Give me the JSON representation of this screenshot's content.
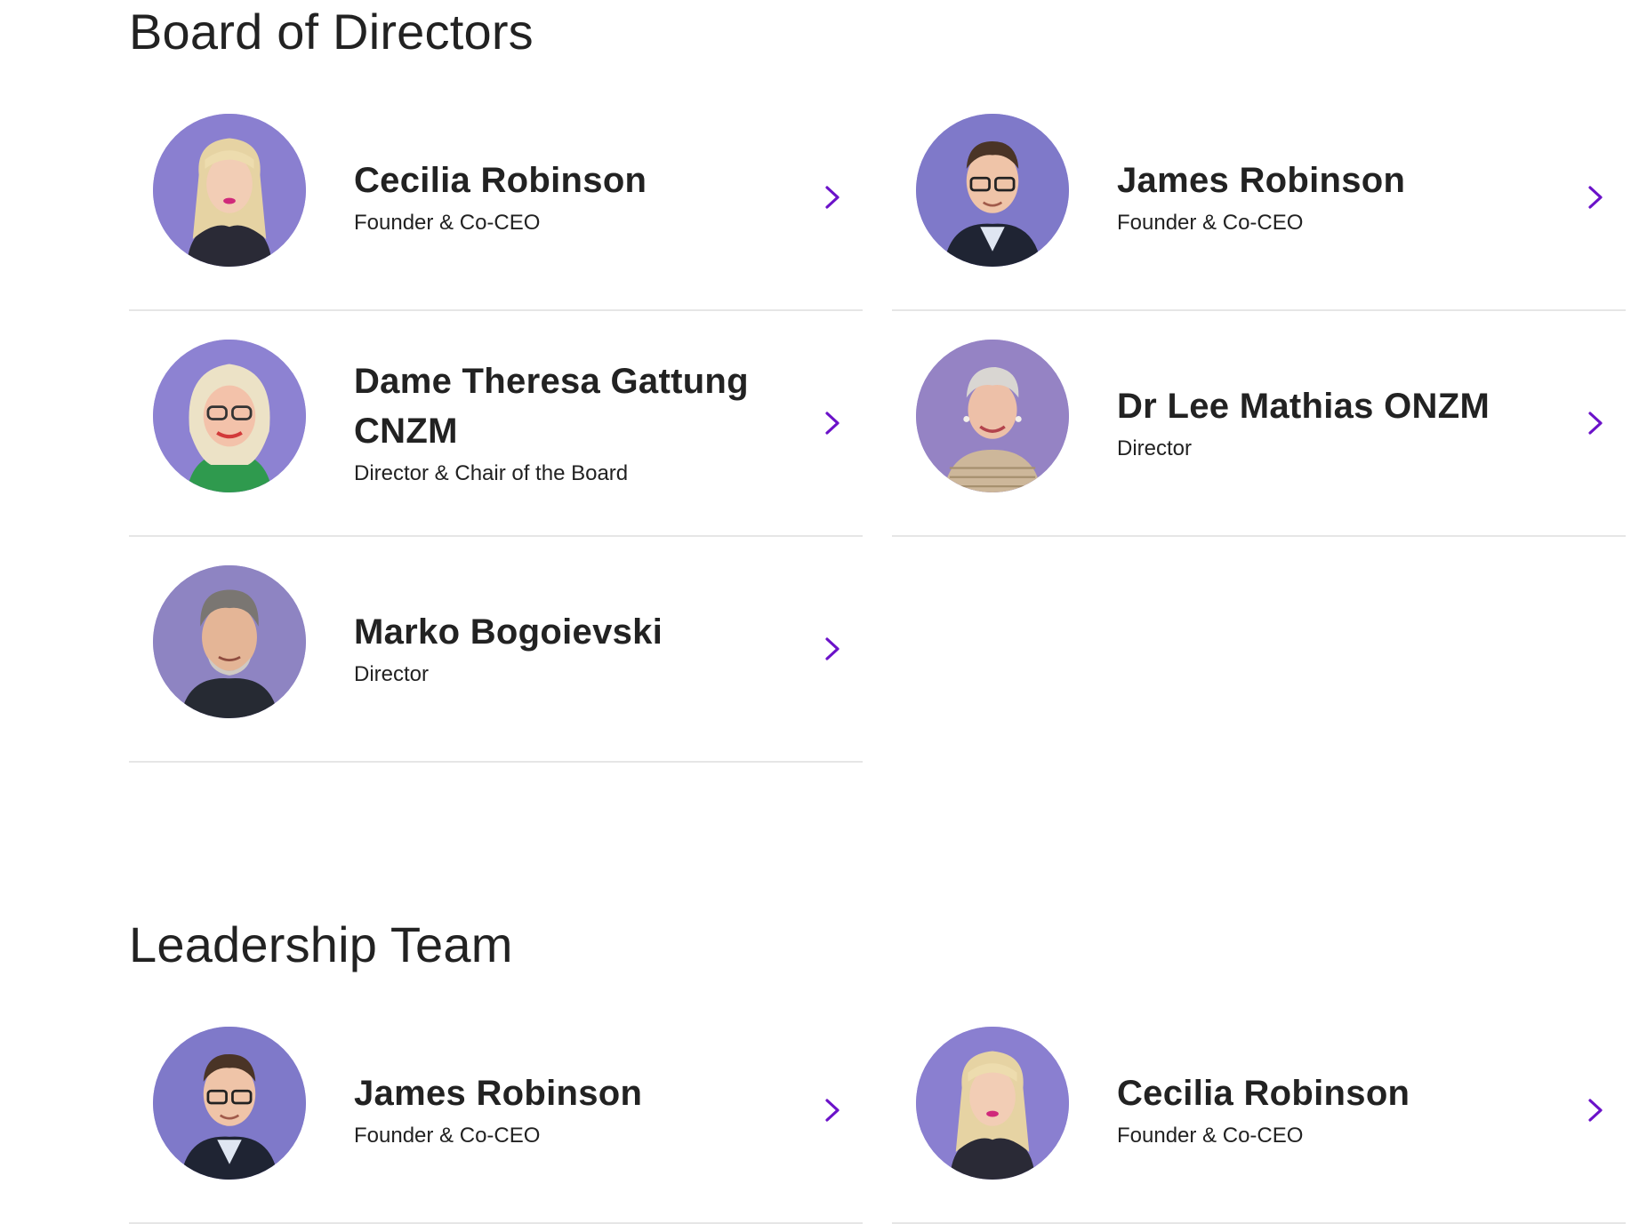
{
  "colors": {
    "accent": "#6b12c9",
    "divider": "#e6e6e6",
    "avatar_background": "#8e7fcf",
    "text": "#222222"
  },
  "board": {
    "title": "Board of Directors",
    "members": [
      {
        "name": "Cecilia Robinson",
        "role": "Founder & Co-CEO",
        "chevron_icon": "chevron-right-icon"
      },
      {
        "name": "James Robinson",
        "role": "Founder & Co-CEO",
        "chevron_icon": "chevron-right-icon"
      },
      {
        "name": "Dame Theresa Gattung CNZM",
        "role": "Director & Chair of the Board",
        "chevron_icon": "chevron-right-icon"
      },
      {
        "name": "Dr Lee Mathias ONZM",
        "role": "Director",
        "chevron_icon": "chevron-right-icon"
      },
      {
        "name": "Marko Bogoievski",
        "role": "Director",
        "chevron_icon": "chevron-right-icon"
      }
    ]
  },
  "leadership": {
    "title": "Leadership Team",
    "members": [
      {
        "name": "James Robinson",
        "role": "Founder & Co-CEO",
        "chevron_icon": "chevron-right-icon"
      },
      {
        "name": "Cecilia Robinson",
        "role": "Founder & Co-CEO",
        "chevron_icon": "chevron-right-icon"
      }
    ]
  }
}
